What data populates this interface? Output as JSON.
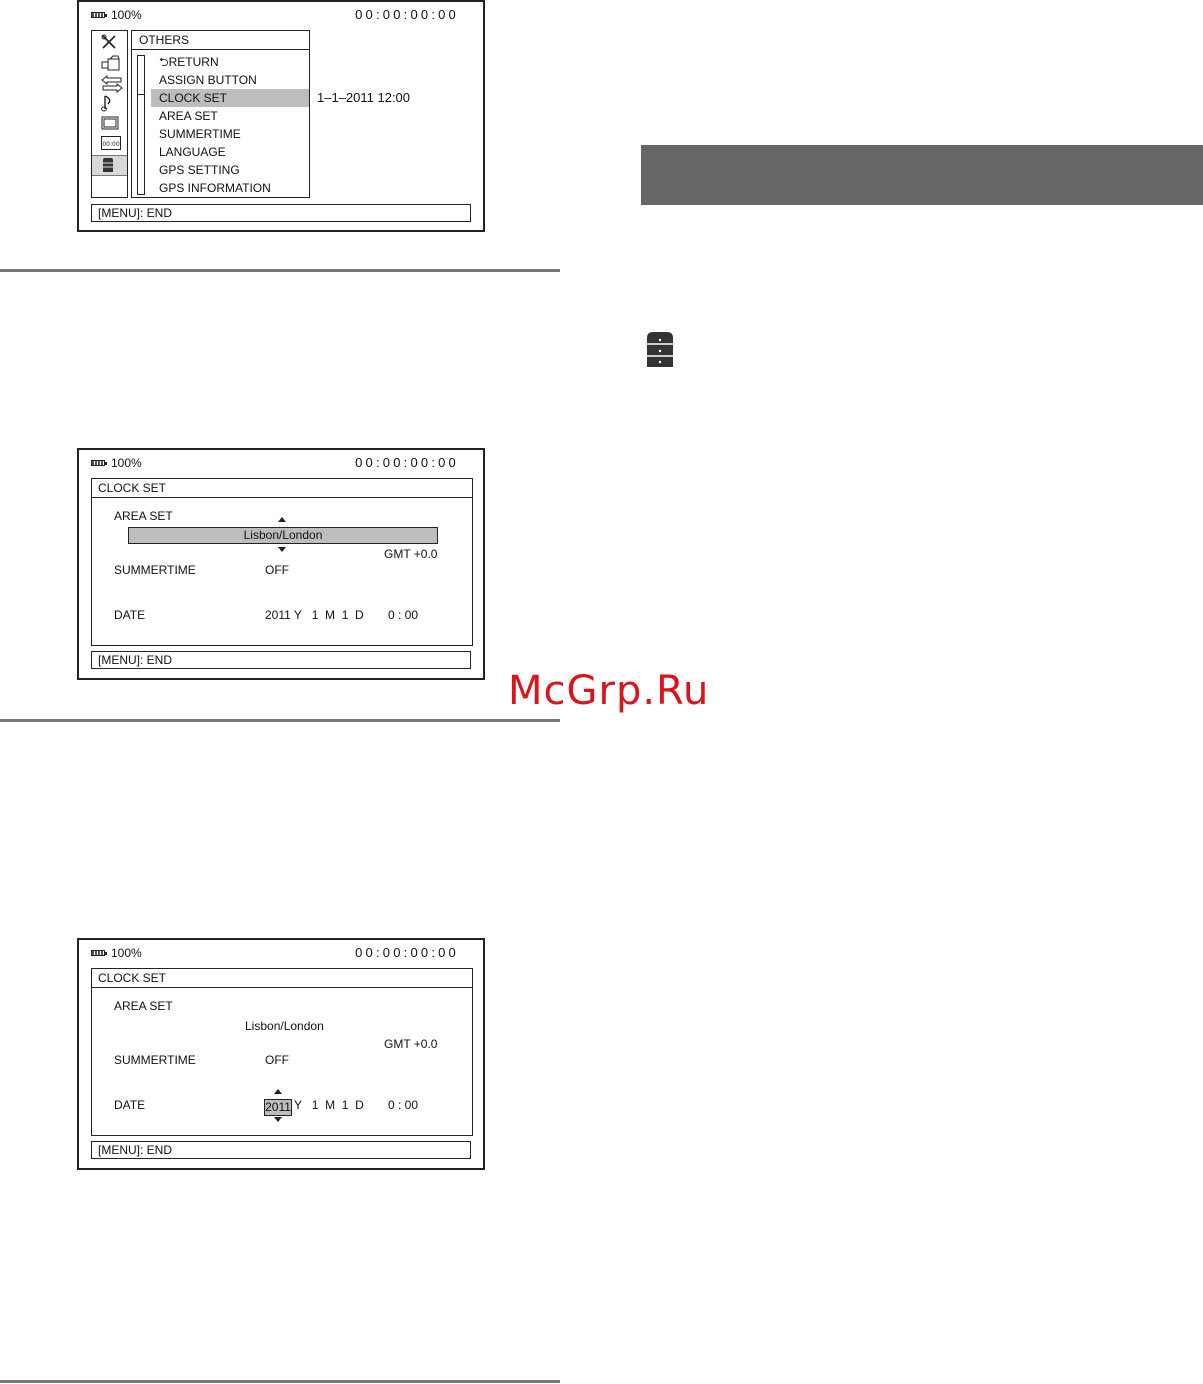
{
  "status": {
    "battery": "100%",
    "timecode": "00:00:00:00"
  },
  "menu_screen": {
    "title": "OTHERS",
    "items": [
      {
        "label": "RETURN"
      },
      {
        "label": "ASSIGN BUTTON"
      },
      {
        "label": "CLOCK SET"
      },
      {
        "label": "AREA SET"
      },
      {
        "label": "SUMMERTIME"
      },
      {
        "label": "LANGUAGE"
      },
      {
        "label": "GPS SETTING"
      },
      {
        "label": "GPS INFORMATION"
      }
    ],
    "selected_index": 2,
    "selected_value": "1–1–2011  12:00",
    "footer": "[MENU]: END",
    "icons": [
      "tools-icon",
      "camera-icon",
      "transfer-icon",
      "music-note-icon",
      "display-icon",
      "timecode-icon",
      "others-icon"
    ],
    "timecode_icon_text": "00:00"
  },
  "clock_set_area": {
    "title": "CLOCK SET",
    "area_label": "AREA SET",
    "area_value": "Lisbon/London",
    "gmt": "GMT +0.0",
    "summertime_label": "SUMMERTIME",
    "summertime_value": "OFF",
    "date_label": "DATE",
    "date_value": "2011 Y   1  M  1  D",
    "time_value": "0 : 00",
    "footer": "[MENU]: END"
  },
  "clock_set_date": {
    "title": "CLOCK SET",
    "area_label": "AREA SET",
    "area_value": "Lisbon/London",
    "gmt": "GMT +0.0",
    "summertime_label": "SUMMERTIME",
    "summertime_value": "OFF",
    "date_label": "DATE",
    "year_value": "2011",
    "date_rest": "Y   1  M  1  D",
    "time_value": "0 : 00",
    "footer": "[MENU]: END"
  },
  "watermark": "McGrp.Ru",
  "colors": {
    "banner": "#666666",
    "highlight": "#bdbdbd",
    "watermark": "#d9141b"
  }
}
